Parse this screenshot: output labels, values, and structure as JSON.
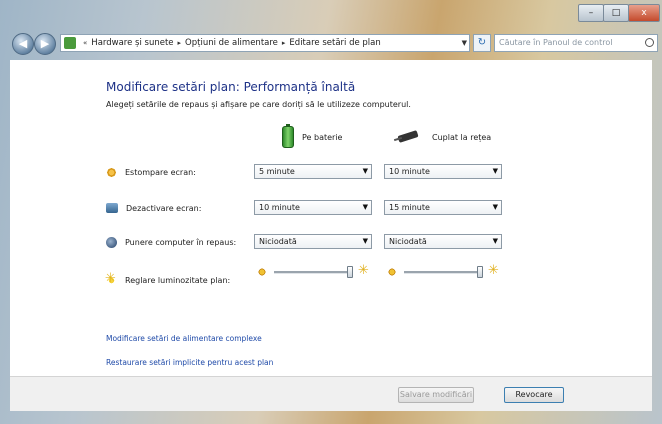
{
  "window": {
    "minimize": "–",
    "maximize": "□",
    "close": "x"
  },
  "nav": {
    "back": "◀",
    "forward": "▶",
    "breadcrumbs": [
      "Hardware și sunete",
      "Opțiuni de alimentare",
      "Editare setări de plan"
    ],
    "root_chevron": "«",
    "separator": "▸",
    "dropdown": "▼",
    "refresh": "↻",
    "search_placeholder": "Căutare în Panoul de control"
  },
  "page": {
    "title": "Modificare setări plan: Performanță înaltă",
    "subtitle": "Alegeți setările de repaus și afișare pe care doriți să le utilizeze computerul."
  },
  "columns": {
    "battery": "Pe baterie",
    "plugged": "Cuplat la rețea"
  },
  "settings": [
    {
      "label": "Estompare ecran:",
      "battery": "5 minute",
      "plugged": "10 minute",
      "icon": "dim-display-icon"
    },
    {
      "label": "Dezactivare ecran:",
      "battery": "10 minute",
      "plugged": "15 minute",
      "icon": "display-off-icon"
    },
    {
      "label": "Punere computer în repaus:",
      "battery": "Niciodată",
      "plugged": "Niciodată",
      "icon": "sleep-icon"
    }
  ],
  "brightness": {
    "label": "Reglare luminozitate plan:",
    "battery_level": 1.0,
    "plugged_level": 1.0
  },
  "links": {
    "advanced": "Modificare setări de alimentare complexe",
    "restore": "Restaurare setări implicite pentru acest plan"
  },
  "buttons": {
    "save": "Salvare modificări",
    "cancel": "Revocare"
  }
}
